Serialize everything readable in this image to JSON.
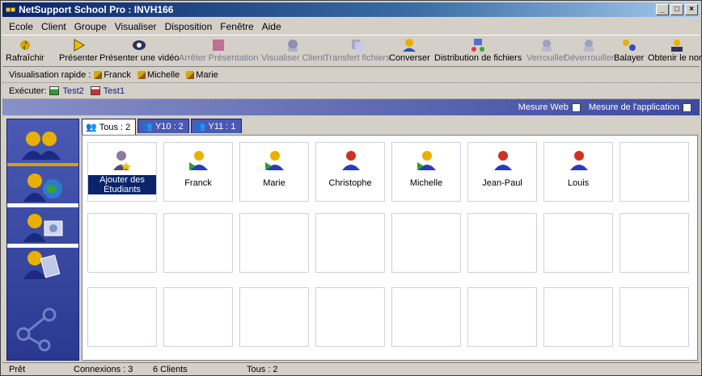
{
  "window": {
    "title": "NetSupport School Pro : INVH166"
  },
  "menu": [
    "Ecole",
    "Client",
    "Groupe",
    "Visualiser",
    "Disposition",
    "Fenêtre",
    "Aide"
  ],
  "toolbar": [
    {
      "label": "Rafraîchir",
      "icon": "refresh-icon",
      "enabled": true
    },
    {
      "label": "Présenter",
      "icon": "play-icon",
      "enabled": true
    },
    {
      "label": "Présenter une vidéo",
      "icon": "video-icon",
      "enabled": true
    },
    {
      "label": "Arrêter Présentation",
      "icon": "stop-icon",
      "enabled": false
    },
    {
      "label": "Visualiser Client",
      "icon": "view-client-icon",
      "enabled": false
    },
    {
      "label": "Transfert fichiers",
      "icon": "file-transfer-icon",
      "enabled": false
    },
    {
      "label": "Converser",
      "icon": "chat-icon",
      "enabled": true
    },
    {
      "label": "Distribution de fichiers",
      "icon": "file-distribution-icon",
      "enabled": true
    },
    {
      "label": "Verrouiller",
      "icon": "lock-icon",
      "enabled": false
    },
    {
      "label": "Déverrouiller",
      "icon": "unlock-icon",
      "enabled": false
    },
    {
      "label": "Balayer",
      "icon": "scan-icon",
      "enabled": true
    },
    {
      "label": "Obtenir le nom",
      "icon": "get-name-icon",
      "enabled": true
    }
  ],
  "quickview": {
    "label": "Visualisation rapide :",
    "items": [
      "Franck",
      "Michelle",
      "Marie"
    ]
  },
  "run": {
    "label": "Exécuter:",
    "items": [
      "Test2",
      "Test1"
    ]
  },
  "measure": {
    "web": "Mesure Web",
    "app": "Mesure de l'application"
  },
  "tabs": [
    "Tous : 2",
    "Y10 : 2",
    "Y11 : 1"
  ],
  "cells": [
    "Ajouter des Etudiants",
    "Franck",
    "Marie",
    "Christophe",
    "Michelle",
    "Jean-Paul",
    "Louis"
  ],
  "status": {
    "ready": "Prêt",
    "connections": "Connexions : 3",
    "clients": "6 Clients",
    "all": "Tous : 2"
  },
  "colors": {
    "title": "#0a246a",
    "sidebar": "#3c4aa0",
    "selection": "#0a246a"
  }
}
